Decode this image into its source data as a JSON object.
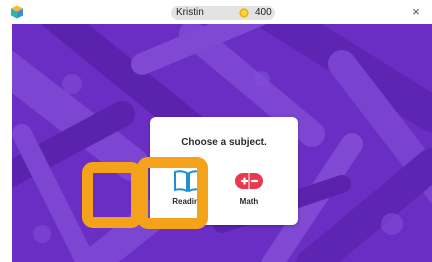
{
  "titlebar": {
    "app_icon": "cube-icon",
    "user_name": "Kristin",
    "coin_icon": "coin-icon",
    "coins": "400",
    "close_label": "×"
  },
  "stage": {
    "background_color": "#6b2ec4"
  },
  "dialog": {
    "title": "Choose a subject.",
    "subjects": [
      {
        "label": "Reading",
        "icon": "book-icon"
      },
      {
        "label": "Math",
        "icon": "plus-minus-icon"
      }
    ]
  },
  "highlight_color": "#f5a21b"
}
